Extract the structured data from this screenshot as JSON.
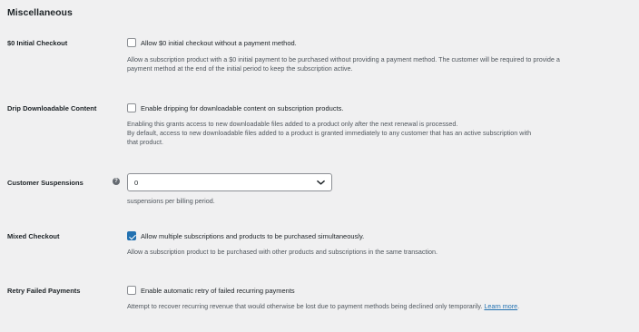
{
  "section": {
    "title": "Miscellaneous"
  },
  "initial_checkout": {
    "label": "$0 Initial Checkout",
    "checkbox_label": "Allow $0 initial checkout without a payment method.",
    "checked": false,
    "description_line1": "Allow a subscription product with a $0 initial payment to be purchased without providing a payment method. The customer will be required to provide a",
    "description_line2": "payment method at the end of the initial period to keep the subscription active."
  },
  "drip_content": {
    "label": "Drip Downloadable Content",
    "checkbox_label": "Enable dripping for downloadable content on subscription products.",
    "checked": false,
    "description_line1": "Enabling this grants access to new downloadable files added to a product only after the next renewal is processed.",
    "description_line2": "By default, access to new downloadable files added to a product is granted immediately to any customer that has an active subscription with",
    "description_line3": "that product."
  },
  "customer_suspensions": {
    "label": "Customer Suspensions",
    "help_icon": "question-mark-icon",
    "select_value": "0",
    "description": "suspensions per billing period."
  },
  "mixed_checkout": {
    "label": "Mixed Checkout",
    "checkbox_label": "Allow multiple subscriptions and products to be purchased simultaneously.",
    "checked": true,
    "description": "Allow a subscription product to be purchased with other products and subscriptions in the same transaction."
  },
  "retry_failed": {
    "label": "Retry Failed Payments",
    "checkbox_label": "Enable automatic retry of failed recurring payments",
    "checked": false,
    "description": "Attempt to recover recurring revenue that would otherwise be lost due to payment methods being declined only temporarily.",
    "link_text": "Learn more",
    "after_link": "."
  },
  "colors": {
    "background": "#f0f0f1",
    "accent": "#2271b1",
    "text": "#1d2327",
    "muted": "#50575e"
  }
}
